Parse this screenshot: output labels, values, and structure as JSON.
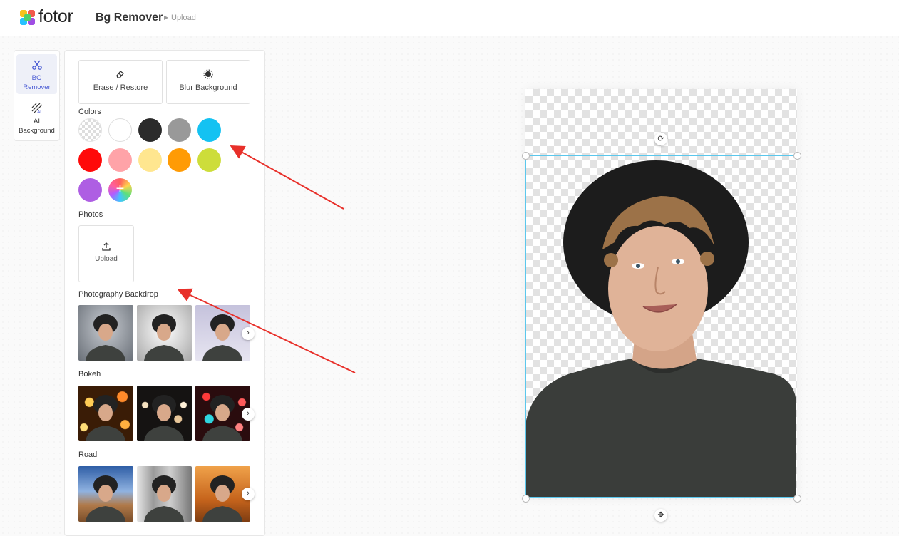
{
  "header": {
    "brand": "fotor",
    "title": "Bg Remover",
    "breadcrumb": "Upload"
  },
  "rail": {
    "items": [
      {
        "label_line1": "BG",
        "label_line2": "Remover",
        "icon": "scissors-icon",
        "active": true
      },
      {
        "label_line1": "AI",
        "label_line2": "Background",
        "icon": "ai-background-icon",
        "active": false
      }
    ]
  },
  "tools": {
    "erase_label": "Erase / Restore",
    "blur_label": "Blur Background"
  },
  "colors": {
    "label": "Colors",
    "swatches": [
      "transparent",
      "#ffffff",
      "#2b2b2b",
      "#999999",
      "#14c2f2",
      "#ff0a0a",
      "#ffa3a8",
      "#ffe68f",
      "#ff9b05",
      "#cddd3a",
      "#ae5ee3",
      "custom"
    ]
  },
  "photos": {
    "label": "Photos",
    "upload_label": "Upload"
  },
  "categories": [
    {
      "label": "Photography Backdrop"
    },
    {
      "label": "Bokeh"
    },
    {
      "label": "Road"
    }
  ]
}
